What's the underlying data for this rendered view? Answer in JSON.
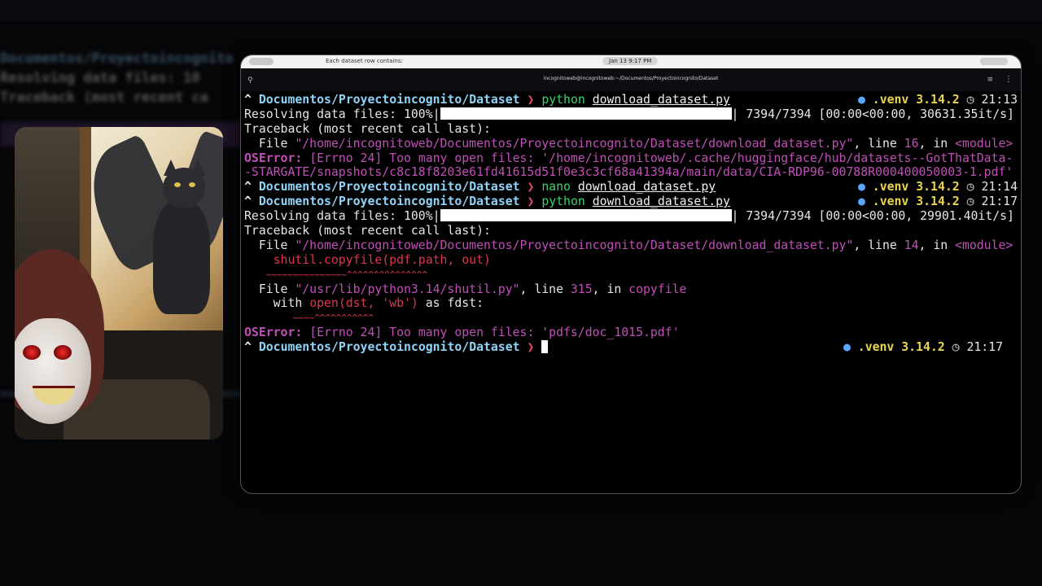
{
  "background": {
    "blur_line_1": "Documentos/Proyectoincognito",
    "blur_line_2": "Resolving data files: 10",
    "blur_line_3": "Traceback (most recent ca"
  },
  "system_bar": {
    "notification": "Each dataset row contains:",
    "datetime": "Jan 13  9:17 PM"
  },
  "terminal": {
    "title": "incognitoweb@incognitoweb:~/Documentos/Proyectoincognito/Dataset",
    "prompt_path": "Documentos/Proyectoincognito/Dataset",
    "prompt_arrow": "^",
    "prompt_chevron": "❯",
    "venv": ".venv 3.14.2",
    "lines": {
      "cmd1_bin": "python",
      "cmd1_arg": "download_dataset.py",
      "cmd1_time": "21:13",
      "resolving_label": "Resolving data files: 100%|",
      "resolving1_stats": "| 7394/7394 [00:00<00:00, 30631.35it/s]",
      "traceback": "Traceback (most recent call last):",
      "tb1_file_prefix": "  File ",
      "tb1_file_path": "\"/home/incognitoweb/Documentos/Proyectoincognito/Dataset/download_dataset.py\"",
      "tb1_line_mid": ", line ",
      "tb1_line_no": "16",
      "tb1_in": ", in ",
      "tb1_module": "<module>",
      "os1_label": "OSError:",
      "os1_msg_a": " [Errno 24] Too many open files: '/home/incognitoweb/.cache/huggingface/hub/datasets--GotThatData-",
      "os1_msg_b": "-STARGATE/snapshots/c8c18f8203e61fd41615d51f0e3c3cf68a41394a/main/data/CIA-RDP96-00788R000400050003-1.pdf'",
      "cmd2_bin": "nano",
      "cmd2_arg": "download_dataset.py",
      "cmd2_time": "21:14",
      "cmd3_bin": "python",
      "cmd3_arg": "download_dataset.py",
      "cmd3_time": "21:17",
      "resolving2_stats": "| 7394/7394 [00:00<00:00, 29901.40it/s]",
      "tb2_file_path": "\"/home/incognitoweb/Documentos/Proyectoincognito/Dataset/download_dataset.py\"",
      "tb2_line_no": "14",
      "tb2_code": "    shutil.copyfile(pdf.path, out)",
      "tb2_carets": "    ~~~~~~~~~~~~~~~^^^^^^^^^^^^^^^",
      "tb3_file_path": "\"/usr/lib/python3.14/shutil.py\"",
      "tb3_line_no": "315",
      "tb3_func": "copyfile",
      "tb3_code_with": "    with ",
      "tb3_code_open": "open(dst, 'wb')",
      "tb3_code_rest": " as fdst:",
      "tb3_carets": "         ~~~~^^^^^^^^^^^",
      "os2_label": "OSError:",
      "os2_msg": " [Errno 24] Too many open files: ",
      "os2_file": "'pdfs/doc_1015.pdf'",
      "final_time": "21:17"
    }
  },
  "colors": {
    "path": "#8fd3f7",
    "command": "#3fd06a",
    "error": "#c14fb8",
    "venv": "#e8d44d",
    "chevron": "#e34b6b"
  },
  "icons": [
    "search-icon",
    "hamburger-menu-icon",
    "more-options-icon",
    "clock-icon",
    "python-dot-icon"
  ]
}
